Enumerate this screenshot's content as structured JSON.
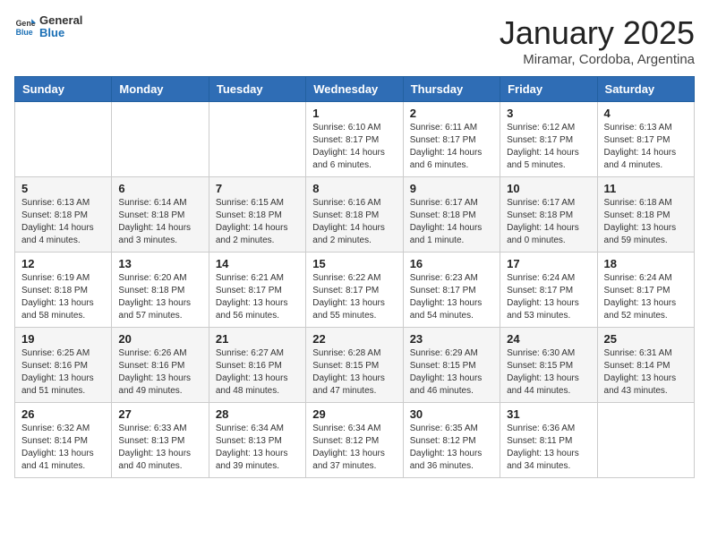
{
  "header": {
    "logo_general": "General",
    "logo_blue": "Blue",
    "month_title": "January 2025",
    "subtitle": "Miramar, Cordoba, Argentina"
  },
  "days_of_week": [
    "Sunday",
    "Monday",
    "Tuesday",
    "Wednesday",
    "Thursday",
    "Friday",
    "Saturday"
  ],
  "weeks": [
    [
      {
        "day": "",
        "info": ""
      },
      {
        "day": "",
        "info": ""
      },
      {
        "day": "",
        "info": ""
      },
      {
        "day": "1",
        "info": "Sunrise: 6:10 AM\nSunset: 8:17 PM\nDaylight: 14 hours\nand 6 minutes."
      },
      {
        "day": "2",
        "info": "Sunrise: 6:11 AM\nSunset: 8:17 PM\nDaylight: 14 hours\nand 6 minutes."
      },
      {
        "day": "3",
        "info": "Sunrise: 6:12 AM\nSunset: 8:17 PM\nDaylight: 14 hours\nand 5 minutes."
      },
      {
        "day": "4",
        "info": "Sunrise: 6:13 AM\nSunset: 8:17 PM\nDaylight: 14 hours\nand 4 minutes."
      }
    ],
    [
      {
        "day": "5",
        "info": "Sunrise: 6:13 AM\nSunset: 8:18 PM\nDaylight: 14 hours\nand 4 minutes."
      },
      {
        "day": "6",
        "info": "Sunrise: 6:14 AM\nSunset: 8:18 PM\nDaylight: 14 hours\nand 3 minutes."
      },
      {
        "day": "7",
        "info": "Sunrise: 6:15 AM\nSunset: 8:18 PM\nDaylight: 14 hours\nand 2 minutes."
      },
      {
        "day": "8",
        "info": "Sunrise: 6:16 AM\nSunset: 8:18 PM\nDaylight: 14 hours\nand 2 minutes."
      },
      {
        "day": "9",
        "info": "Sunrise: 6:17 AM\nSunset: 8:18 PM\nDaylight: 14 hours\nand 1 minute."
      },
      {
        "day": "10",
        "info": "Sunrise: 6:17 AM\nSunset: 8:18 PM\nDaylight: 14 hours\nand 0 minutes."
      },
      {
        "day": "11",
        "info": "Sunrise: 6:18 AM\nSunset: 8:18 PM\nDaylight: 13 hours\nand 59 minutes."
      }
    ],
    [
      {
        "day": "12",
        "info": "Sunrise: 6:19 AM\nSunset: 8:18 PM\nDaylight: 13 hours\nand 58 minutes."
      },
      {
        "day": "13",
        "info": "Sunrise: 6:20 AM\nSunset: 8:18 PM\nDaylight: 13 hours\nand 57 minutes."
      },
      {
        "day": "14",
        "info": "Sunrise: 6:21 AM\nSunset: 8:17 PM\nDaylight: 13 hours\nand 56 minutes."
      },
      {
        "day": "15",
        "info": "Sunrise: 6:22 AM\nSunset: 8:17 PM\nDaylight: 13 hours\nand 55 minutes."
      },
      {
        "day": "16",
        "info": "Sunrise: 6:23 AM\nSunset: 8:17 PM\nDaylight: 13 hours\nand 54 minutes."
      },
      {
        "day": "17",
        "info": "Sunrise: 6:24 AM\nSunset: 8:17 PM\nDaylight: 13 hours\nand 53 minutes."
      },
      {
        "day": "18",
        "info": "Sunrise: 6:24 AM\nSunset: 8:17 PM\nDaylight: 13 hours\nand 52 minutes."
      }
    ],
    [
      {
        "day": "19",
        "info": "Sunrise: 6:25 AM\nSunset: 8:16 PM\nDaylight: 13 hours\nand 51 minutes."
      },
      {
        "day": "20",
        "info": "Sunrise: 6:26 AM\nSunset: 8:16 PM\nDaylight: 13 hours\nand 49 minutes."
      },
      {
        "day": "21",
        "info": "Sunrise: 6:27 AM\nSunset: 8:16 PM\nDaylight: 13 hours\nand 48 minutes."
      },
      {
        "day": "22",
        "info": "Sunrise: 6:28 AM\nSunset: 8:15 PM\nDaylight: 13 hours\nand 47 minutes."
      },
      {
        "day": "23",
        "info": "Sunrise: 6:29 AM\nSunset: 8:15 PM\nDaylight: 13 hours\nand 46 minutes."
      },
      {
        "day": "24",
        "info": "Sunrise: 6:30 AM\nSunset: 8:15 PM\nDaylight: 13 hours\nand 44 minutes."
      },
      {
        "day": "25",
        "info": "Sunrise: 6:31 AM\nSunset: 8:14 PM\nDaylight: 13 hours\nand 43 minutes."
      }
    ],
    [
      {
        "day": "26",
        "info": "Sunrise: 6:32 AM\nSunset: 8:14 PM\nDaylight: 13 hours\nand 41 minutes."
      },
      {
        "day": "27",
        "info": "Sunrise: 6:33 AM\nSunset: 8:13 PM\nDaylight: 13 hours\nand 40 minutes."
      },
      {
        "day": "28",
        "info": "Sunrise: 6:34 AM\nSunset: 8:13 PM\nDaylight: 13 hours\nand 39 minutes."
      },
      {
        "day": "29",
        "info": "Sunrise: 6:34 AM\nSunset: 8:12 PM\nDaylight: 13 hours\nand 37 minutes."
      },
      {
        "day": "30",
        "info": "Sunrise: 6:35 AM\nSunset: 8:12 PM\nDaylight: 13 hours\nand 36 minutes."
      },
      {
        "day": "31",
        "info": "Sunrise: 6:36 AM\nSunset: 8:11 PM\nDaylight: 13 hours\nand 34 minutes."
      },
      {
        "day": "",
        "info": ""
      }
    ]
  ]
}
